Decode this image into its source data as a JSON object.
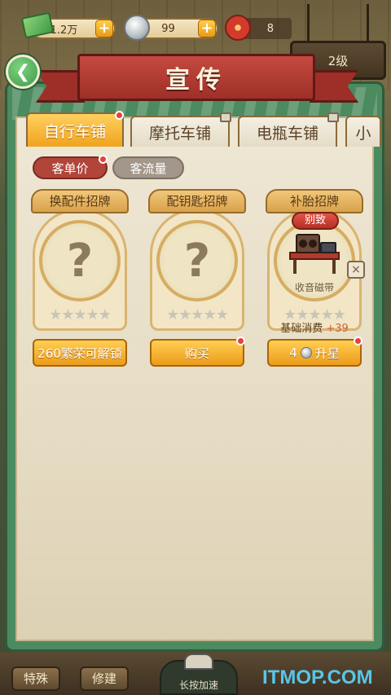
{
  "resources": {
    "money": "1.2万",
    "coins": "99",
    "flowers": "8",
    "plus": "+"
  },
  "level": "2级",
  "back_icon": "back-arrow-icon",
  "title": "宣传",
  "tabs": [
    {
      "label": "自行车铺",
      "state": "active",
      "dot": true
    },
    {
      "label": "摩托车铺",
      "state": "locked"
    },
    {
      "label": "电瓶车铺",
      "state": "locked"
    },
    {
      "label": "小",
      "state": "normal"
    }
  ],
  "categories": [
    {
      "label": "客单价",
      "active": true
    },
    {
      "label": "客流量",
      "active": false
    }
  ],
  "cards": [
    {
      "name": "换配件招牌",
      "unknown": "?",
      "stars": "★★★★★",
      "action": "260繁荣可解锁"
    },
    {
      "name": "配钥匙招牌",
      "unknown": "?",
      "stars": "★★★★★",
      "action": "购买"
    },
    {
      "name": "补胎招牌",
      "rarity": "别致",
      "item": "收音磁带",
      "stars": "★★★★★",
      "stat_label": "基础消费",
      "stat_bonus": "+39",
      "action_count": "4",
      "action_label": "升星"
    }
  ],
  "close": "×",
  "bottom": {
    "special": "特殊",
    "repair": "修建",
    "speed": "长按加速"
  },
  "watermark": "ITMOP.COM",
  "colors": {
    "panel_green": "#4c8a5f",
    "banner_red": "#b23a31",
    "button_orange": "#f0a31e"
  }
}
